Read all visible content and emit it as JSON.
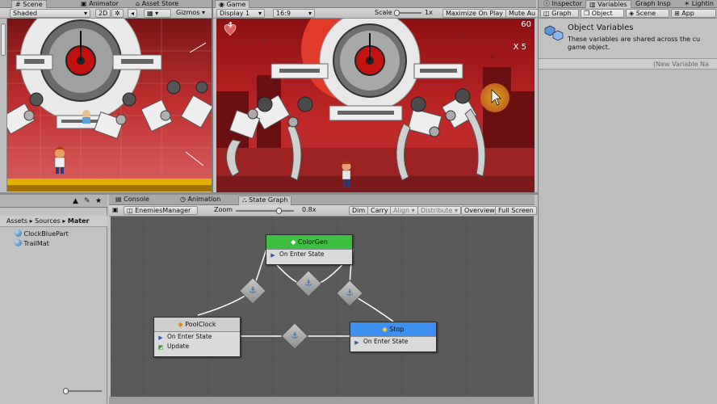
{
  "top_tabs": {
    "scene": "Scene",
    "animator": "Animator",
    "asset_store": "Asset Store",
    "game": "Game"
  },
  "scene_toolbar": {
    "shading": "Shaded",
    "mode_2d": "2D",
    "gizmos": "Gizmos"
  },
  "game_toolbar": {
    "display": "Display 1",
    "aspect": "16:9",
    "scale_label": "Scale",
    "scale_value": "1x",
    "maximize": "Maximize On Play",
    "mute": "Mute Au"
  },
  "game_hud": {
    "lives": "4",
    "score": "60",
    "multiplier": "X 5"
  },
  "bottom_tabs": {
    "console": "Console",
    "animation": "Animation",
    "state_graph": "State Graph"
  },
  "graph_toolbar": {
    "graph_name": "EnemiesManager",
    "zoom_label": "Zoom",
    "zoom_value": "0.8x",
    "dim": "Dim",
    "carry": "Carry",
    "align": "Align",
    "distribute": "Distribute",
    "overview": "Overview",
    "full_screen": "Full Screen"
  },
  "project": {
    "breadcrumb": [
      "Assets",
      "Sources",
      "Mater"
    ],
    "items": [
      "ClockBluePart",
      "TrailMat"
    ]
  },
  "graph": {
    "nodes": [
      {
        "id": "colorgen",
        "title": "ColorGen",
        "head_color": "#3fbf3f",
        "rows": [
          "On Enter State"
        ]
      },
      {
        "id": "poolclock",
        "title": "PoolClock",
        "head_color": "#cfcfcf",
        "rows": [
          "On Enter State",
          "Update"
        ]
      },
      {
        "id": "stop",
        "title": "Stop",
        "head_color": "#3f8ff0",
        "rows": [
          "On Enter State"
        ]
      }
    ]
  },
  "inspector": {
    "tabs": [
      "Inspector",
      "Variables",
      "Graph Insp",
      "Lightin"
    ],
    "sub_tabs": [
      "Graph",
      "Object",
      "Scene",
      "App"
    ],
    "title": "Object Variables",
    "description_line1": "These variables are shared across the cu",
    "description_line2": "game object.",
    "new_variable": "(New Variable Na"
  },
  "colors": {
    "graph_bg": "#5a5a5a",
    "colorgen_green": "#3fbf3f",
    "stop_blue": "#3f8ff0",
    "game_red": "#b01c1c"
  }
}
